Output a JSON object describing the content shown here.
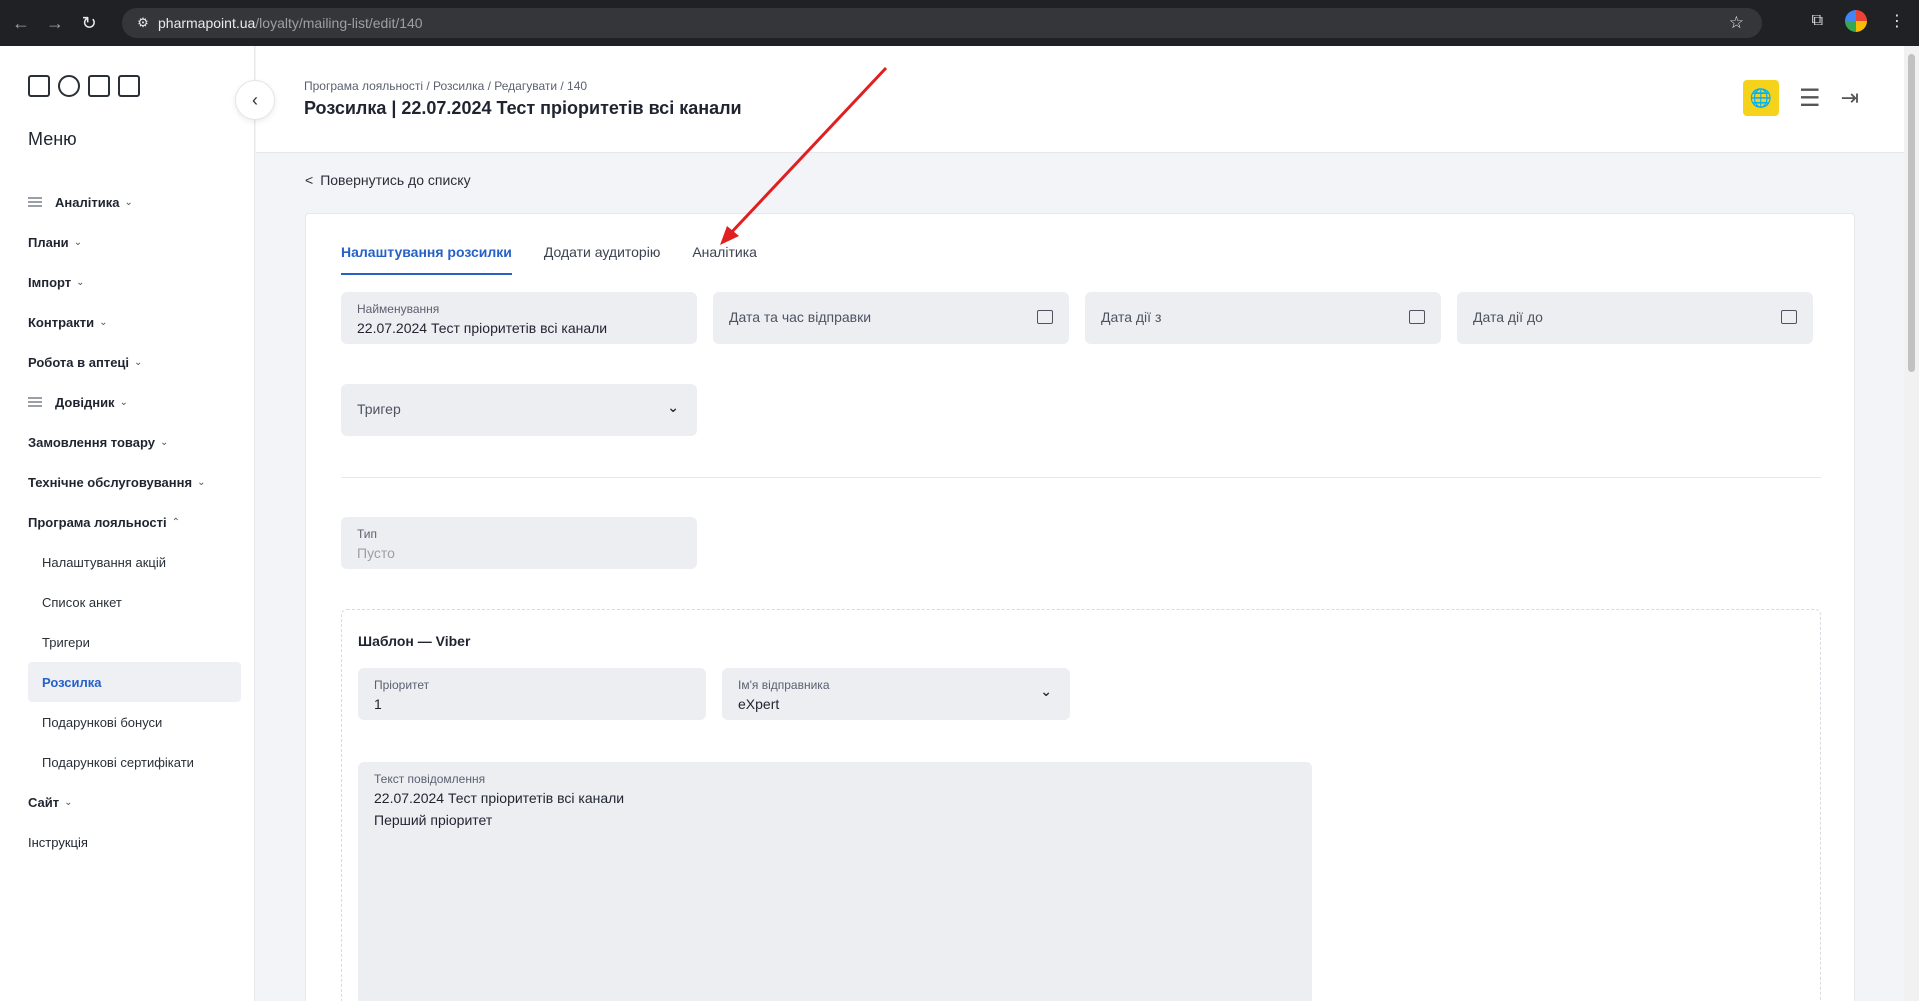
{
  "browser": {
    "url_host": "pharmapoint.ua",
    "url_path": "/loyalty/mailing-list/edit/140"
  },
  "sidebar": {
    "menu_title": "Меню",
    "items": [
      {
        "label": "Аналітика",
        "icon": "table-icon"
      },
      {
        "label": "Плани"
      },
      {
        "label": "Імпорт"
      },
      {
        "label": "Контракти"
      },
      {
        "label": "Робота в аптеці"
      },
      {
        "label": "Довідник",
        "icon": "list-icon"
      },
      {
        "label": "Замовлення товару"
      },
      {
        "label": "Технічне обслуговування"
      },
      {
        "label": "Програма лояльності",
        "expanded": true
      },
      {
        "label": "Налаштування акцій"
      },
      {
        "label": "Список анкет"
      },
      {
        "label": "Тригери"
      },
      {
        "label": "Розсилка",
        "active": true
      },
      {
        "label": "Подарункові бонуси"
      },
      {
        "label": "Подарункові сертифікати"
      },
      {
        "label": "Сайт"
      },
      {
        "label": "Інструкція"
      }
    ]
  },
  "header": {
    "breadcrumb": "Програма лояльності / Розсилка / Редагувати / 140",
    "title": "Розсилка | 22.07.2024 Тест пріоритетів всі канали",
    "accent_color": "#f5d31b"
  },
  "content": {
    "back_label": "Повернутись до списку",
    "tabs": [
      {
        "label": "Налаштування розсилки",
        "active": true
      },
      {
        "label": "Додати аудиторію"
      },
      {
        "label": "Аналітика"
      }
    ],
    "name_field": {
      "label": "Найменування",
      "value": "22.07.2024 Тест пріоритетів всі канали"
    },
    "send_date": {
      "placeholder": "Дата та час відправки"
    },
    "valid_from": {
      "placeholder": "Дата дії з"
    },
    "valid_to": {
      "placeholder": "Дата дії до"
    },
    "trigger": {
      "placeholder": "Тригер"
    },
    "type_field": {
      "label": "Тип",
      "value": "Пусто"
    },
    "template": {
      "title": "Шаблон — Viber",
      "priority": {
        "label": "Пріоритет",
        "value": "1"
      },
      "sender": {
        "label": "Ім'я відправника",
        "value": "eXpert"
      },
      "message": {
        "label": "Текст повідомлення",
        "line1": "22.07.2024 Тест пріоритетів всі канали",
        "line2": "Перший пріоритет"
      }
    }
  },
  "colors": {
    "primary": "#2561c8",
    "annotation_arrow": "#e02020"
  }
}
